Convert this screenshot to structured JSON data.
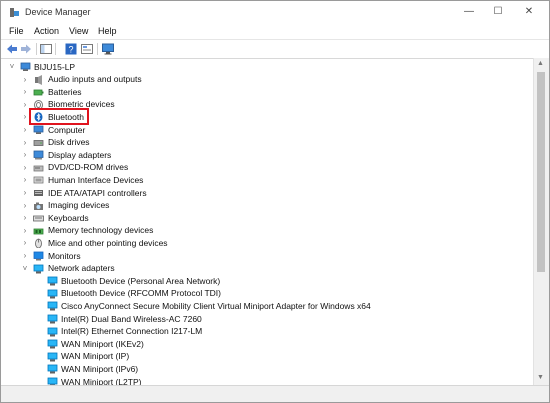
{
  "window": {
    "title": "Device Manager"
  },
  "titlebar_buttons": {
    "minimize": "—",
    "maximize": "☐",
    "close": "✕"
  },
  "menu": [
    "File",
    "Action",
    "View",
    "Help"
  ],
  "toolbar": {
    "icons": [
      "back-icon",
      "forward-icon",
      "show-hide-console-tree-icon",
      "help-icon",
      "properties-icon",
      "monitor-icon"
    ]
  },
  "tree": {
    "root": "BIJU15-LP",
    "categories": [
      "Audio inputs and outputs",
      "Batteries",
      "Biometric devices",
      "Bluetooth",
      "Computer",
      "Disk drives",
      "Display adapters",
      "DVD/CD-ROM drives",
      "Human Interface Devices",
      "IDE ATA/ATAPI controllers",
      "Imaging devices",
      "Keyboards",
      "Memory technology devices",
      "Mice and other pointing devices",
      "Monitors",
      "Network adapters"
    ],
    "network_adapters": [
      "Bluetooth Device (Personal Area Network)",
      "Bluetooth Device (RFCOMM Protocol TDI)",
      "Cisco AnyConnect Secure Mobility Client Virtual Miniport Adapter for Windows x64",
      "Intel(R) Dual Band Wireless-AC 7260",
      "Intel(R) Ethernet Connection I217-LM",
      "WAN Miniport (IKEv2)",
      "WAN Miniport (IP)",
      "WAN Miniport (IPv6)",
      "WAN Miniport (L2TP)"
    ],
    "highlighted": "Bluetooth",
    "highlight_color": "#e0141e"
  },
  "colors": {
    "accent": "#1a73c9",
    "highlight": "#e0141e"
  }
}
